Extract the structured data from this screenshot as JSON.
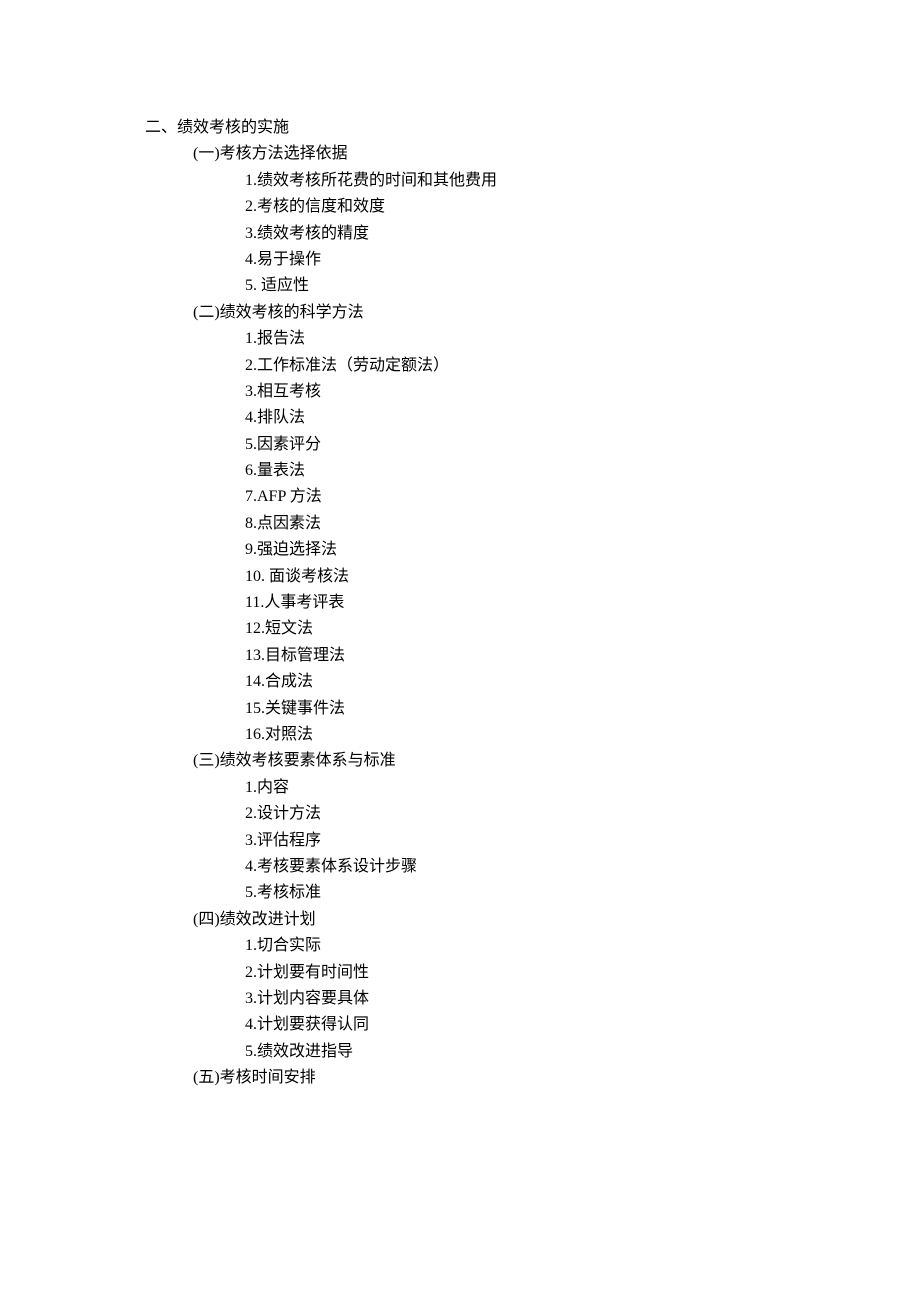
{
  "heading": "二、绩效考核的实施",
  "sections": [
    {
      "title": "(一)考核方法选择依据",
      "items": [
        "1.绩效考核所花费的时间和其他费用",
        "2.考核的信度和效度",
        "3.绩效考核的精度",
        "4.易于操作",
        "5.  适应性"
      ]
    },
    {
      "title": "(二)绩效考核的科学方法",
      "items": [
        "1.报告法",
        "2.工作标准法（劳动定额法）",
        "3.相互考核",
        "4.排队法",
        "5.因素评分",
        "6.量表法",
        "7.AFP 方法",
        "8.点因素法",
        "9.强迫选择法",
        "10.  面谈考核法",
        "11.人事考评表",
        "12.短文法",
        "13.目标管理法",
        "14.合成法",
        "15.关键事件法",
        "16.对照法"
      ]
    },
    {
      "title": "(三)绩效考核要素体系与标准",
      "items": [
        "1.内容",
        "2.设计方法",
        "3.评估程序",
        "4.考核要素体系设计步骤",
        "5.考核标准"
      ]
    },
    {
      "title": "(四)绩效改进计划",
      "items": [
        "1.切合实际",
        "2.计划要有时间性",
        "3.计划内容要具体",
        "4.计划要获得认同",
        "5.绩效改进指导"
      ]
    },
    {
      "title": "(五)考核时间安排",
      "items": []
    }
  ]
}
